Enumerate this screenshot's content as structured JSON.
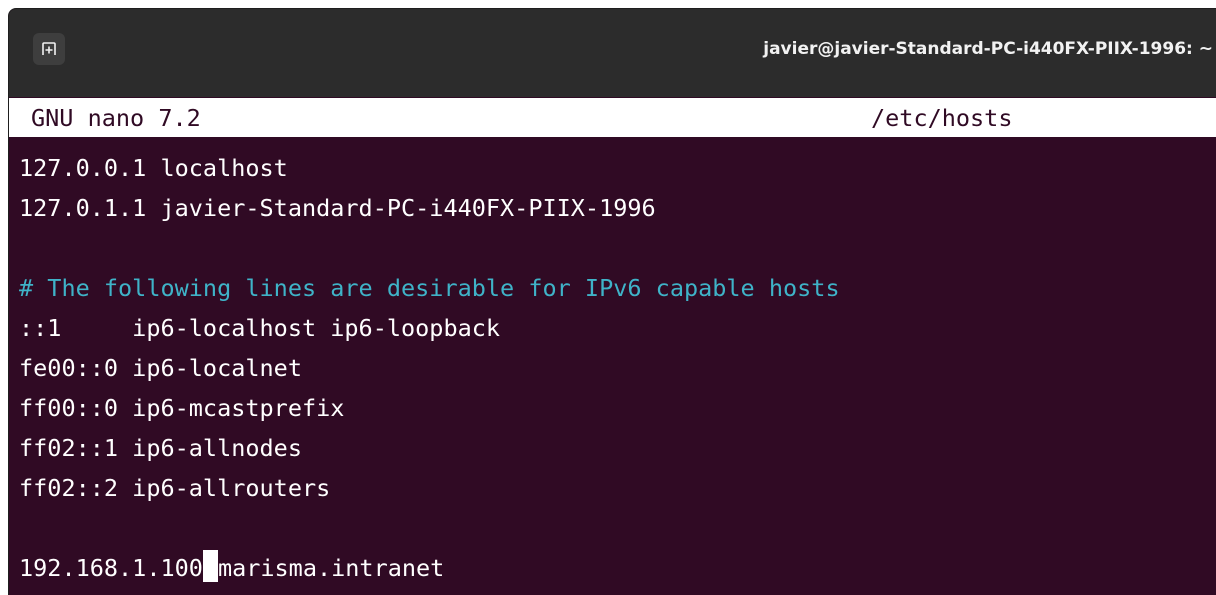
{
  "window": {
    "title": "javier@javier-Standard-PC-i440FX-PIIX-1996: ~"
  },
  "icons": {
    "new_tab": "new-tab-icon"
  },
  "nano": {
    "program": "GNU nano 7.2",
    "filename": "/etc/hosts"
  },
  "file_lines": [
    "127.0.0.1 localhost",
    "127.0.1.1 javier-Standard-PC-i440FX-PIIX-1996",
    "",
    "# The following lines are desirable for IPv6 capable hosts",
    "::1     ip6-localhost ip6-loopback",
    "fe00::0 ip6-localnet",
    "ff00::0 ip6-mcastprefix",
    "ff02::1 ip6-allnodes",
    "ff02::2 ip6-allrouters",
    ""
  ],
  "last_line": {
    "before_cursor": "192.168.1.100",
    "after_cursor": "marisma.intranet"
  },
  "colors": {
    "terminal_bg": "#300a24",
    "comment": "#3fb3c8",
    "titlebar_bg": "#2c2c2c"
  }
}
